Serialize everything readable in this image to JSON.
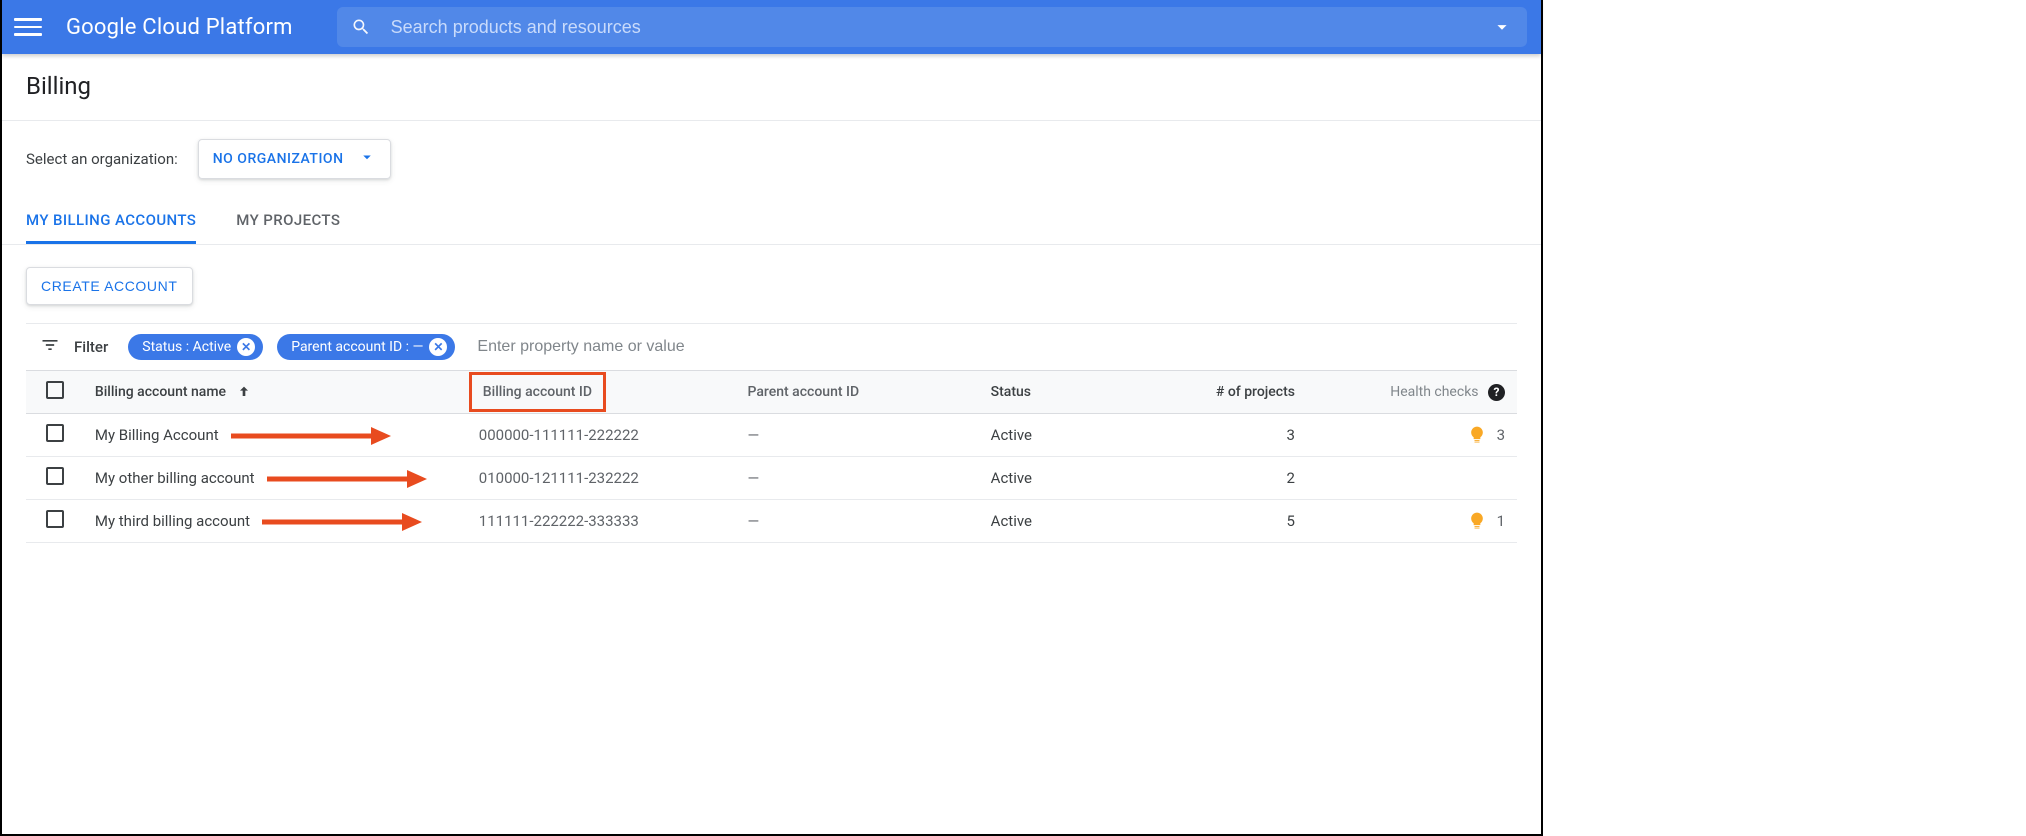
{
  "header": {
    "product_name": "Google Cloud Platform",
    "search_placeholder": "Search products and resources"
  },
  "page": {
    "title": "Billing",
    "org_selector_label": "Select an organization:",
    "org_selected": "NO ORGANIZATION"
  },
  "tabs": [
    {
      "label": "MY BILLING ACCOUNTS",
      "active": true
    },
    {
      "label": "MY PROJECTS",
      "active": false
    }
  ],
  "actions": {
    "create_account": "CREATE ACCOUNT"
  },
  "filter": {
    "label": "Filter",
    "chips": [
      {
        "text": "Status : Active"
      },
      {
        "text": "Parent account ID : —"
      }
    ],
    "input_placeholder": "Enter property name or value"
  },
  "table": {
    "columns": {
      "name": "Billing account name",
      "id": "Billing account ID",
      "parent": "Parent account ID",
      "status": "Status",
      "projects": "# of projects",
      "health": "Health checks"
    },
    "rows": [
      {
        "name": "My Billing Account",
        "id": "000000-111111-222222",
        "parent": "—",
        "status": "Active",
        "projects": "3",
        "health": "3",
        "has_bulb": true
      },
      {
        "name": "My other billing account",
        "id": "010000-121111-232222",
        "parent": "—",
        "status": "Active",
        "projects": "2",
        "health": "",
        "has_bulb": false
      },
      {
        "name": "My third billing account",
        "id": "111111-222222-333333",
        "parent": "—",
        "status": "Active",
        "projects": "5",
        "health": "1",
        "has_bulb": true
      }
    ]
  },
  "icons": {
    "hamburger": "menu-icon",
    "search": "search-icon",
    "expand": "chevron-down-icon",
    "dropdown": "dropdown-arrow-icon",
    "filter": "filter-icon",
    "sort": "arrow-up-icon",
    "help": "help-icon",
    "bulb": "lightbulb-icon",
    "chip_close": "close-icon"
  },
  "colors": {
    "primary": "#3B78E7",
    "link": "#1A73E8",
    "annotation": "#E84B1F",
    "bulb": "#F9A825"
  }
}
